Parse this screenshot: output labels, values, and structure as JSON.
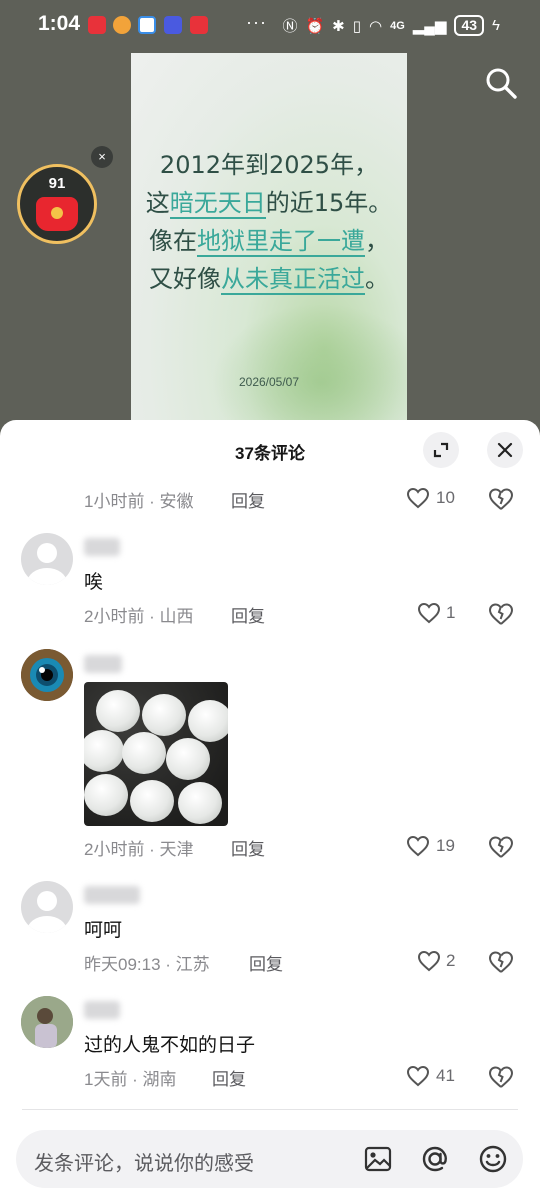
{
  "status": {
    "time": "1:04",
    "dots": "···",
    "network": "4G",
    "battery": "43",
    "notification_colors": [
      "#e8323a",
      "#f2a33a",
      "#3a8ee8",
      "#4a5ae0",
      "#e8323a"
    ]
  },
  "poster": {
    "line1": "2012年到2025年，",
    "line2_pre": "这",
    "line2_hl": "暗无天日",
    "line2_post": "的近15年。",
    "line3_pre": "像在",
    "line3_hl": "地狱里走了一遭",
    "line3_post": "，",
    "line4_pre": "又好像",
    "line4_hl": "从未真正活过",
    "line4_post": "。",
    "date": "2026/05/07"
  },
  "redpacket": {
    "count": "91",
    "close": "×"
  },
  "sheet": {
    "title": "37条评论",
    "reply_label": "回复"
  },
  "comments": [
    {
      "time": "1小时前 · 安徽",
      "likes": "10"
    },
    {
      "text": "唉",
      "time": "2小时前 · 山西",
      "likes": "1"
    },
    {
      "time": "2小时前 · 天津",
      "likes": "19"
    },
    {
      "text": "呵呵",
      "time": "昨天09:13 · 江苏",
      "likes": "2"
    },
    {
      "text": "过的人鬼不如的日子",
      "time": "1天前 · 湖南",
      "likes": "41"
    }
  ],
  "input": {
    "placeholder": "发条评论，说说你的感受"
  },
  "icons": [
    "search-icon",
    "expand-icon",
    "close-icon",
    "heart-icon",
    "broken-heart-icon",
    "image-icon",
    "at-icon",
    "emoji-icon"
  ],
  "colors": {
    "accent_teal": "#3aa89a",
    "redpacket": "#e8262f"
  }
}
